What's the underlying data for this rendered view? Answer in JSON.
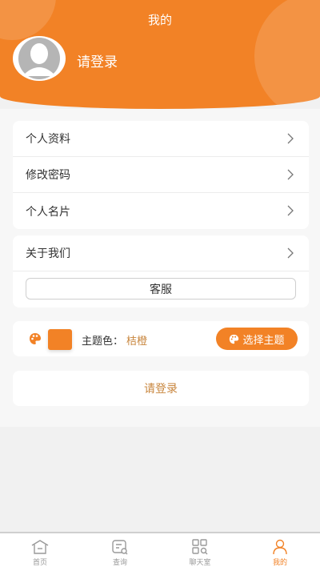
{
  "header": {
    "title": "我的",
    "login_prompt": "请登录"
  },
  "menu": {
    "group1": [
      "个人资料",
      "修改密码",
      "个人名片"
    ],
    "group2": [
      "关于我们"
    ],
    "service_button": "客服"
  },
  "theme": {
    "label": "主题色：",
    "value": "桔橙",
    "choose_button": "选择主题",
    "color": "#f28226"
  },
  "login_button": "请登录",
  "tabs": [
    {
      "label": "首页",
      "icon": "home-icon"
    },
    {
      "label": "查询",
      "icon": "search-doc-icon"
    },
    {
      "label": "聊天室",
      "icon": "chatroom-icon"
    },
    {
      "label": "我的",
      "icon": "user-icon",
      "active": true
    }
  ],
  "colors": {
    "accent": "#f28226",
    "accent_text": "#c8863e"
  }
}
